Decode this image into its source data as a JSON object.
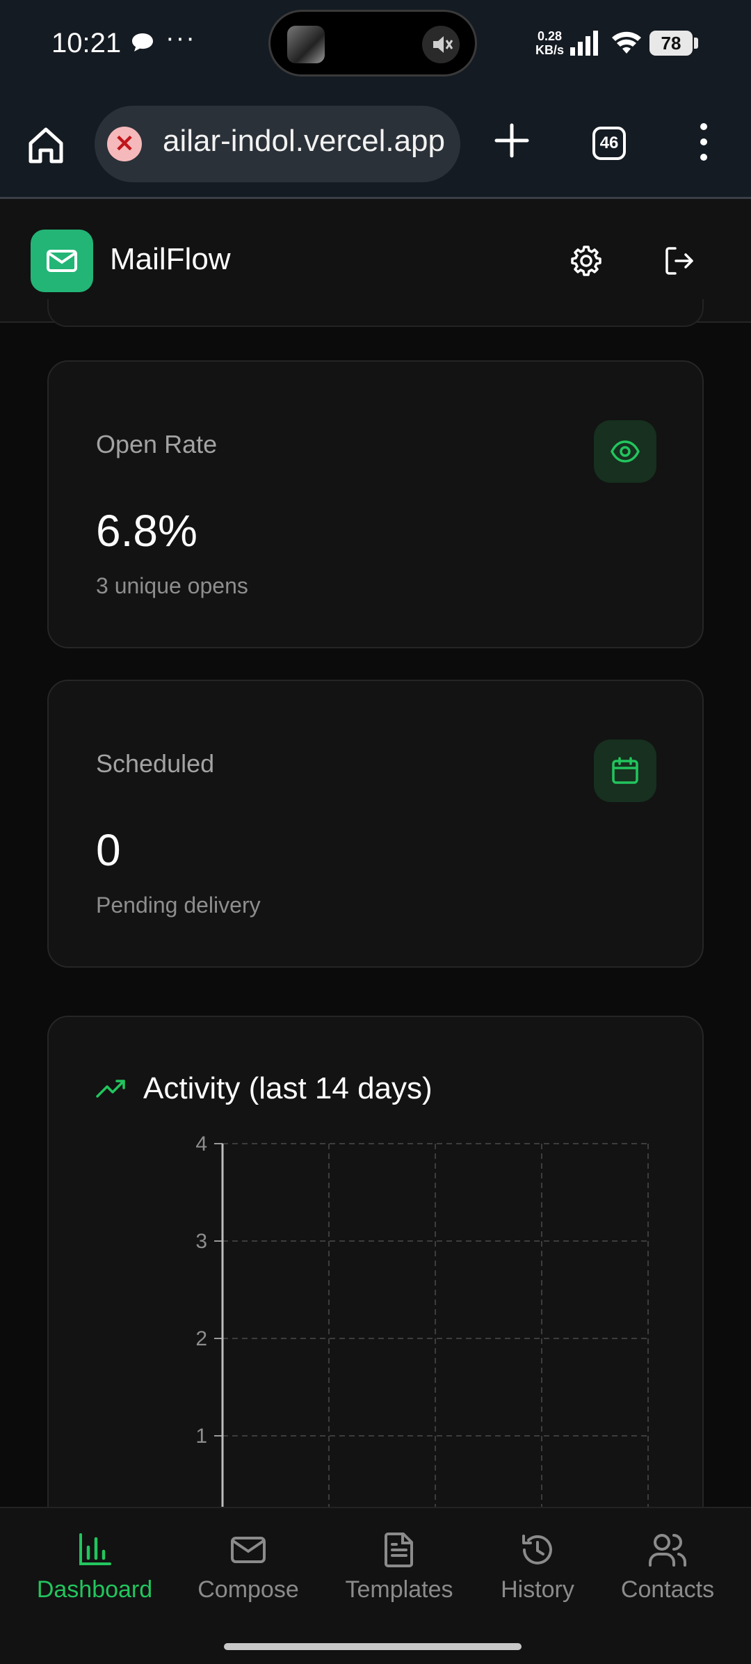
{
  "status_bar": {
    "time": "10:21",
    "more": "···",
    "network_speed_value": "0.28",
    "network_speed_unit": "KB/s",
    "battery": "78"
  },
  "browser": {
    "url": "ailar-indol.vercel.app",
    "tab_count": "46"
  },
  "app": {
    "brand": "MailFlow",
    "accent_color": "#22c55e"
  },
  "stats": [
    {
      "label": "Open Rate",
      "value": "6.8%",
      "sub": "3 unique opens",
      "icon": "eye-icon"
    },
    {
      "label": "Scheduled",
      "value": "0",
      "sub": "Pending delivery",
      "icon": "calendar-icon"
    }
  ],
  "activity": {
    "title": "Activity (last 14 days)",
    "icon": "trending-up-icon"
  },
  "chart_data": {
    "type": "line",
    "title": "Activity (last 14 days)",
    "y_ticks": [
      "4",
      "3",
      "2",
      "1"
    ],
    "ylim": [
      0,
      4
    ],
    "grid": true
  },
  "nav": [
    {
      "label": "Dashboard",
      "icon": "bar-chart-icon",
      "active": true
    },
    {
      "label": "Compose",
      "icon": "mail-icon",
      "active": false
    },
    {
      "label": "Templates",
      "icon": "file-text-icon",
      "active": false
    },
    {
      "label": "History",
      "icon": "history-icon",
      "active": false
    },
    {
      "label": "Contacts",
      "icon": "users-icon",
      "active": false
    }
  ]
}
